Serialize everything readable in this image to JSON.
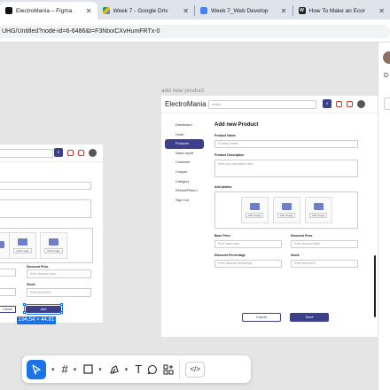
{
  "tabs": [
    {
      "title": "ElectroMania – Figma",
      "icon": "figma-icon",
      "active": true
    },
    {
      "title": "Week 7 - Google Driv",
      "icon": "google-drive-icon",
      "active": false
    },
    {
      "title": "Week 7_Web Develop",
      "icon": "google-docs-icon",
      "active": false
    },
    {
      "title": "How To Make an Ecor",
      "icon": "wix-icon",
      "active": false
    }
  ],
  "address": {
    "url": "UHG/Untitled?node-id=6-6486&t=F3NtxxCXvHumFRTx-0"
  },
  "canvas": {
    "frame_label": "add new product",
    "dimension_badge": "194.54 × 44.81"
  },
  "right_panel": {
    "letter": "D"
  },
  "app": {
    "logo": "ElectroMania",
    "search_placeholder": "search",
    "sidebar": [
      "Dashboard",
      "Order",
      "Products",
      "Sales report",
      "Customer",
      "Coupon",
      "Category",
      "Refund/Return",
      "Sign Out"
    ],
    "active_sidebar": "Products",
    "form": {
      "title": "Add new Product",
      "product_name_label": "Product Name",
      "product_name_placeholder": "Clothing mobile",
      "description_label": "Product Description",
      "description_placeholder": "Write your description here...",
      "photos_label": "Add photos",
      "add_image": "Add Image",
      "base_price_label": "Base Price",
      "base_price_placeholder": "Enter base price",
      "discount_price_label": "Discount Price",
      "discount_price_placeholder": "Enter discount price",
      "discount_pct_label": "Discount Percentage",
      "discount_pct_placeholder": "Enter discount percentage",
      "stock_label": "Stock",
      "stock_placeholder": "Enter stock field",
      "cancel": "Cancel",
      "save": "Save"
    },
    "left_frame": {
      "discount_price_label": "Discount Price",
      "discount_price_placeholder": "Enter discount price",
      "stock_label": "Stock",
      "stock_placeholder": "Enter stock field",
      "cancel": "Cancel",
      "add": "Add"
    }
  },
  "toolbar": {
    "tools": [
      "move-tool",
      "frame-tool",
      "shape-tool",
      "pen-tool",
      "text-tool",
      "comment-tool",
      "actions-tool",
      "dev-mode-toggle"
    ]
  },
  "colors": {
    "accent": "#3b3f8c",
    "selection": "#1a73e8"
  }
}
